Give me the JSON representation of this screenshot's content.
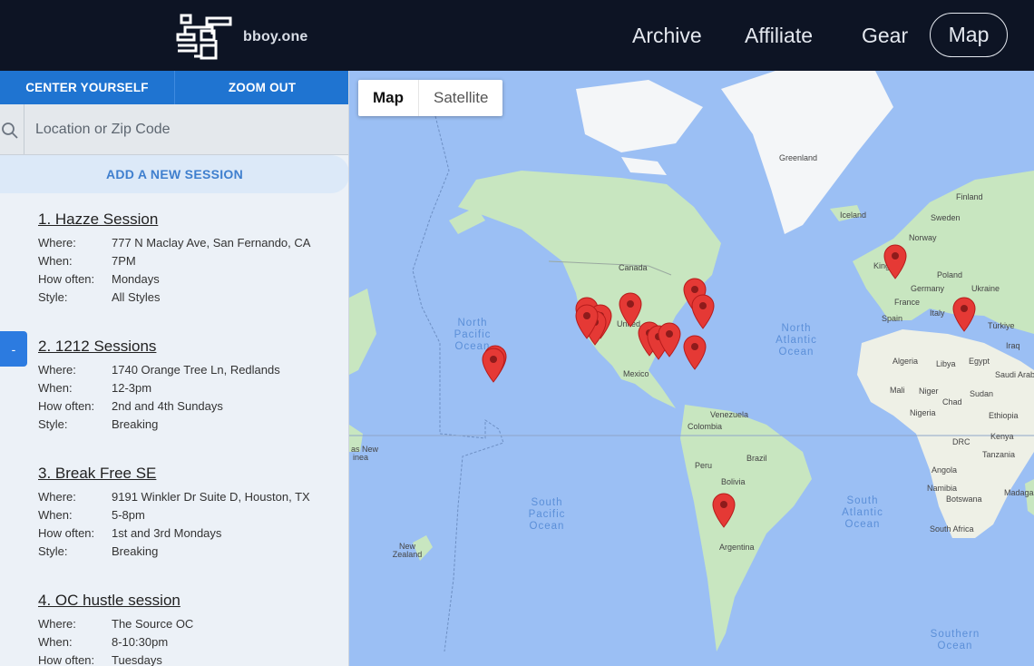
{
  "header": {
    "brand": "bboy.one",
    "nav": [
      "Archive",
      "Affiliate",
      "Gear",
      "Map"
    ]
  },
  "sidebar": {
    "center_button": "CENTER YOURSELF",
    "zoom_button": "ZOOM OUT",
    "search_placeholder": "Location or Zip Code",
    "add_session": "ADD A NEW SESSION",
    "collapse_label": "-",
    "field_labels": {
      "where": "Where:",
      "when": "When:",
      "how_often": "How often:",
      "style": "Style:"
    },
    "sessions": [
      {
        "title": "1. Hazze Session",
        "where": "777 N Maclay Ave, San Fernando, CA",
        "when": "7PM",
        "how_often": "Mondays",
        "style": "All Styles"
      },
      {
        "title": "2. 1212 Sessions",
        "where": "1740 Orange Tree Ln, Redlands",
        "when": "12-3pm",
        "how_often": "2nd and 4th Sundays",
        "style": "Breaking"
      },
      {
        "title": "3. Break Free SE",
        "where": "9191 Winkler Dr Suite D, Houston, TX",
        "when": "5-8pm",
        "how_often": "1st and 3rd Mondays",
        "style": "Breaking"
      },
      {
        "title": "4. OC hustle session",
        "where": "The Source OC",
        "when": "8-10:30pm",
        "how_often": "Tuesdays",
        "style": ""
      }
    ]
  },
  "map": {
    "type_map": "Map",
    "type_satellite": "Satellite",
    "colors": {
      "water": "#9bbff4",
      "land": "#c8e6c0",
      "ice": "#f4f6f8",
      "pin": "#e53935"
    },
    "labels": [
      "Greenland",
      "Iceland",
      "Finland",
      "Sweden",
      "Norway",
      "Poland",
      "Germany",
      "Ukraine",
      "France",
      "Italy",
      "Spain",
      "Türkiye",
      "Iraq",
      "Algeria",
      "Libya",
      "Egypt",
      "Saudi Arab",
      "Mali",
      "Niger",
      "Chad",
      "Sudan",
      "Nigeria",
      "Ethiopia",
      "Kenya",
      "DRC",
      "Tanzania",
      "Angola",
      "Namibia",
      "Botswana",
      "Madagas",
      "South Africa",
      "Canada",
      "United",
      "Mexico",
      "Venezuela",
      "Colombia",
      "Brazil",
      "Peru",
      "Bolivia",
      "Argentina",
      "Kingd",
      "New Zealand",
      "as New",
      "inea"
    ],
    "oceans": [
      "North Pacific Ocean",
      "North Atlantic Ocean",
      "South Pacific Ocean",
      "South Atlantic Ocean",
      "Southern Ocean"
    ]
  }
}
